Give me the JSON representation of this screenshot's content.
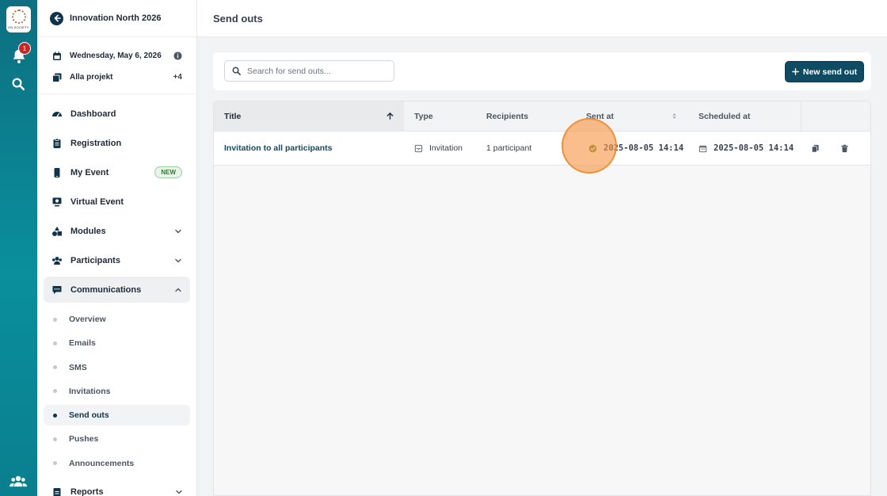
{
  "rail": {
    "logo_text": "KN SOCIETY",
    "notification_count": "1",
    "icons": [
      "bell-icon",
      "search-icon",
      "people-icon"
    ]
  },
  "sidebar": {
    "event_name": "Innovation North 2026",
    "date": "Wednesday, May 6, 2026",
    "projects": "Alla projekt",
    "projects_extra": "+4",
    "nav": [
      {
        "label": "Dashboard",
        "icon": "gauge-icon"
      },
      {
        "label": "Registration",
        "icon": "clipboard-icon"
      },
      {
        "label": "My Event",
        "icon": "phone-icon",
        "badge": "NEW"
      },
      {
        "label": "Virtual Event",
        "icon": "monitor-icon"
      },
      {
        "label": "Modules",
        "icon": "shapes-icon",
        "expandable": true
      },
      {
        "label": "Participants",
        "icon": "users-icon",
        "expandable": true
      },
      {
        "label": "Communications",
        "icon": "chat-icon",
        "expanded": true
      }
    ],
    "communications_sub": [
      {
        "label": "Overview"
      },
      {
        "label": "Emails"
      },
      {
        "label": "SMS"
      },
      {
        "label": "Invitations"
      },
      {
        "label": "Send outs",
        "active": true
      },
      {
        "label": "Pushes"
      },
      {
        "label": "Announcements"
      }
    ],
    "reports_label": "Reports"
  },
  "page": {
    "title": "Send outs",
    "search_placeholder": "Search for send outs...",
    "new_button": "New send out"
  },
  "table": {
    "columns": [
      "Title",
      "Type",
      "Recipients",
      "Sent at",
      "Scheduled at"
    ],
    "rows": [
      {
        "title": "Invitation to all participants",
        "type": "Invitation",
        "recipients": "1 participant",
        "sent_at": "2025-08-05 14:14",
        "scheduled_at": "2025-08-05 14:14"
      }
    ]
  },
  "colors": {
    "primary": "#0f4c63",
    "rail": "#0a8f9d",
    "sent_status": "#6b8e23",
    "new_badge": "#2e7d32"
  }
}
